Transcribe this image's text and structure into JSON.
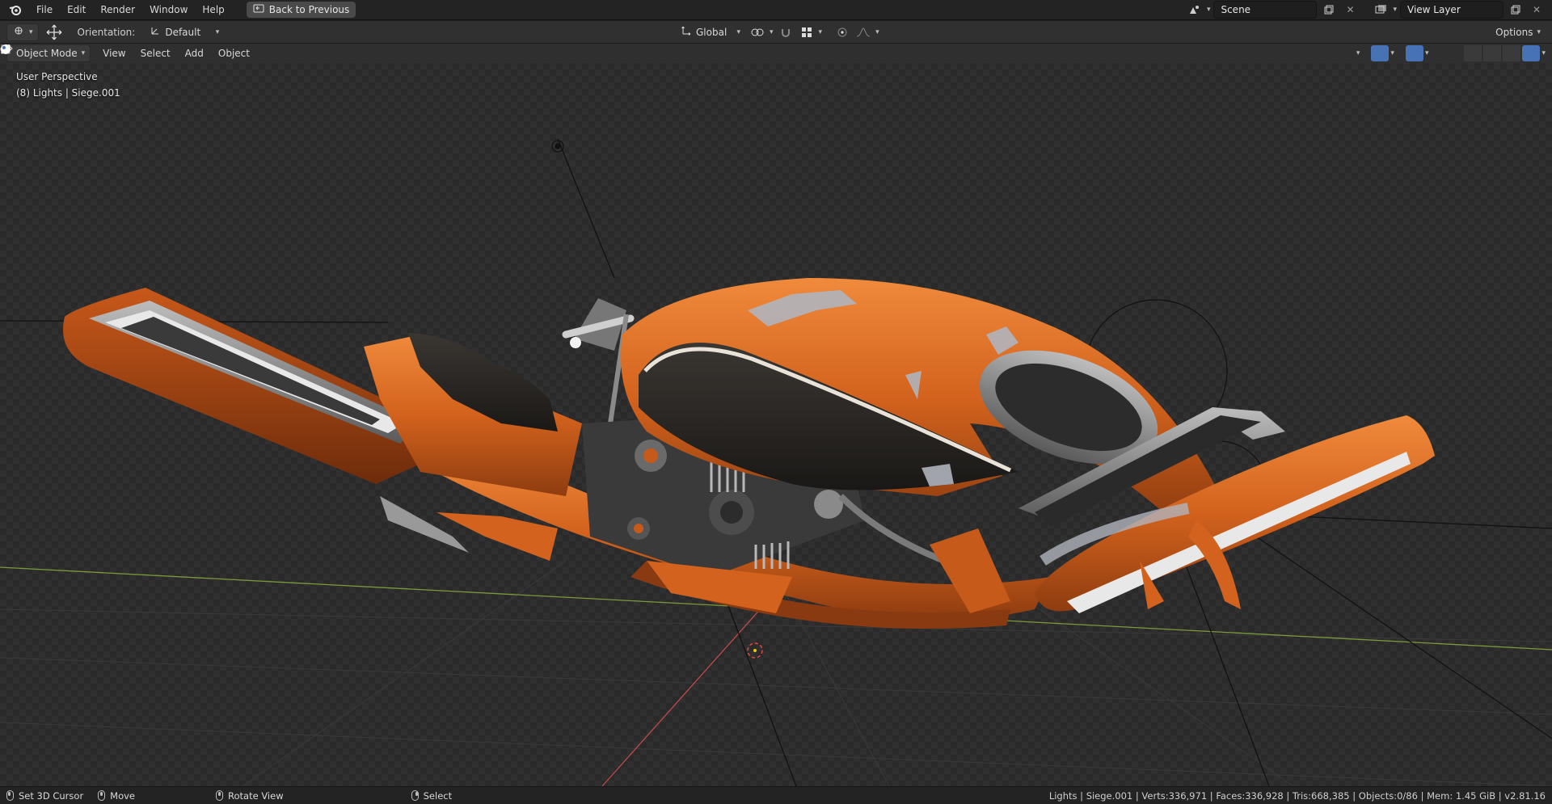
{
  "menu": {
    "items": [
      "File",
      "Edit",
      "Render",
      "Window",
      "Help"
    ],
    "back_button": "Back to Previous"
  },
  "scene": {
    "icon": "scene-icon",
    "name": "Scene"
  },
  "view_layer": {
    "icon": "view-layer-icon",
    "name": "View Layer"
  },
  "toolbar": {
    "orientation_label": "Orientation:",
    "orientation_value": "Default",
    "transform_space": "Global",
    "options_label": "Options"
  },
  "header": {
    "mode": "Object Mode",
    "menus": [
      "View",
      "Select",
      "Add",
      "Object"
    ]
  },
  "viewport": {
    "perspective": "User Perspective",
    "context": "(8) Lights | Siege.001"
  },
  "status": {
    "hints": [
      {
        "mouse": "left",
        "label": "Set 3D Cursor"
      },
      {
        "mouse": "middle",
        "label": "Move"
      },
      {
        "mouse": "middle",
        "label": "Rotate View"
      },
      {
        "mouse": "right",
        "label": "Select"
      }
    ],
    "stats": "Lights | Siege.001 | Verts:336,971 | Faces:336,928 | Tris:668,385 | Objects:0/86 | Mem: 1.45 GiB | v2.81.16"
  },
  "colors": {
    "accent": "#4772b3",
    "bike_orange": "#d2621d",
    "x_axis": "#c04a4a",
    "y_axis": "#7a9a3a"
  }
}
